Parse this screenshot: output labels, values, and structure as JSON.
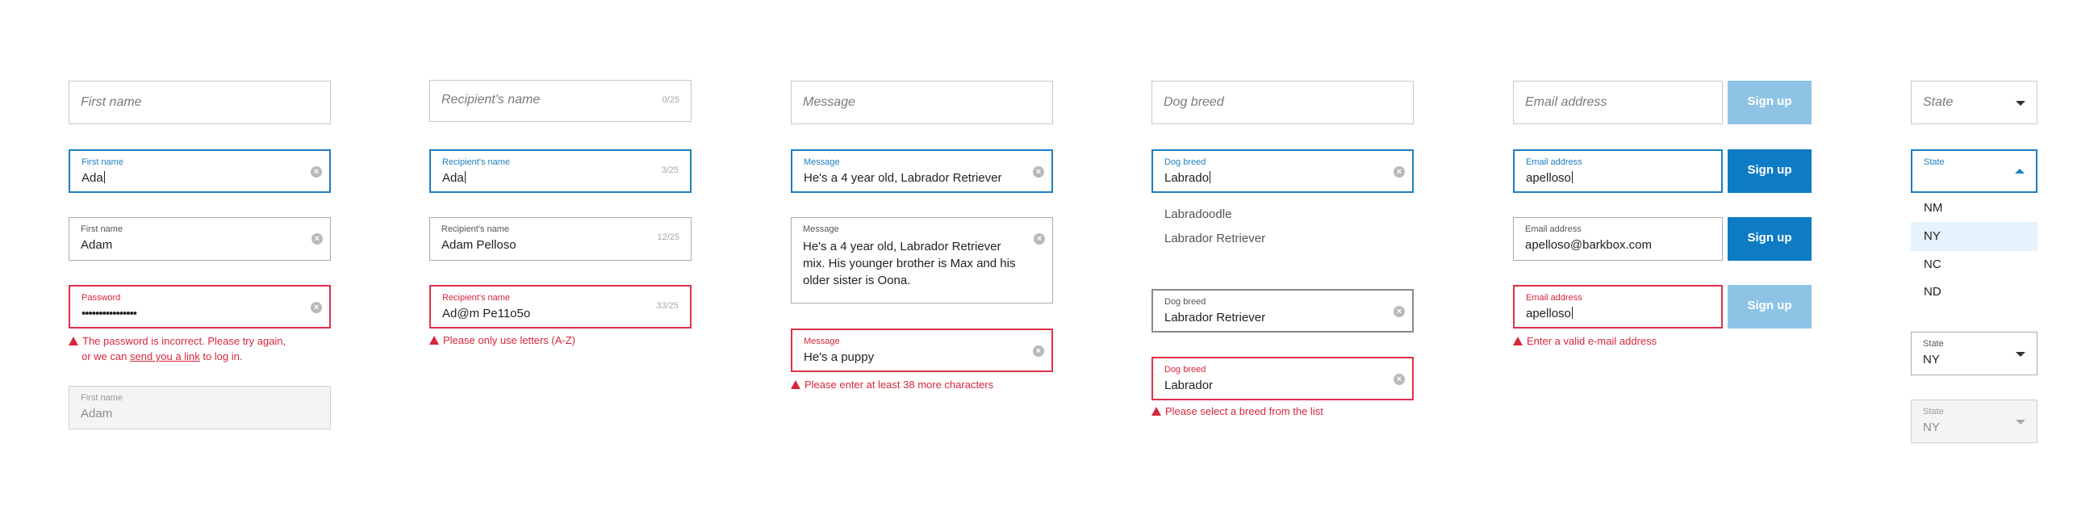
{
  "col1": {
    "empty": {
      "placeholder": "First name"
    },
    "focused": {
      "label": "First name",
      "value": "Ada"
    },
    "filled": {
      "label": "First name",
      "value": "Adam"
    },
    "error": {
      "label": "Password",
      "value": "••••••••••••••••",
      "msg_before": "The password is incorrect. Please try again,",
      "msg_or": "or we can ",
      "msg_link": "send you a link",
      "msg_after": " to log in."
    },
    "disabled": {
      "label": "First name",
      "value": "Adam"
    }
  },
  "col2": {
    "empty": {
      "placeholder": "Recipient's name",
      "count": "0/25"
    },
    "focused": {
      "label": "Recipient's name",
      "value": "Ada",
      "count": "3/25"
    },
    "filled": {
      "label": "Recipient's name",
      "value": "Adam Pelloso",
      "count": "12/25"
    },
    "error": {
      "label": "Recipient's name",
      "value": "Ad@m Pe11o5o",
      "count": "33/25",
      "msg": "Please only use letters (A-Z)"
    }
  },
  "col3": {
    "empty": {
      "placeholder": "Message"
    },
    "focused": {
      "label": "Message",
      "value": "He's a 4 year old, Labrador Retriever"
    },
    "filled": {
      "label": "Message",
      "value": "He's a 4 year old, Labrador Retriever mix. His younger brother is Max and his older sister is Oona."
    },
    "error": {
      "label": "Message",
      "value": "He's a puppy",
      "msg": "Please enter at least 38 more characters"
    }
  },
  "col4": {
    "empty": {
      "placeholder": "Dog breed"
    },
    "focused": {
      "label": "Dog breed",
      "value": "Labrado"
    },
    "suggestions": [
      "Labradoodle",
      "Labrador Retriever"
    ],
    "filled": {
      "label": "Dog breed",
      "value": "Labrador Retriever"
    },
    "error": {
      "label": "Dog breed",
      "value": "Labrador",
      "msg": "Please select a breed from the list"
    }
  },
  "col5": {
    "empty": {
      "placeholder": "Email address",
      "button": "Sign up"
    },
    "focused": {
      "label": "Email address",
      "value": "apelloso",
      "button": "Sign up"
    },
    "filled": {
      "label": "Email address",
      "value": "apelloso@barkbox.com",
      "button": "Sign up"
    },
    "error": {
      "label": "Email address",
      "value": "apelloso",
      "button": "Sign up",
      "msg": "Enter a valid e-mail address"
    }
  },
  "col6": {
    "empty": {
      "placeholder": "State"
    },
    "open": {
      "label": "State",
      "options": [
        "NM",
        "NY",
        "NC",
        "ND"
      ],
      "highlighted": "NY"
    },
    "filled": {
      "label": "State",
      "value": "NY"
    },
    "disabled": {
      "label": "State",
      "value": "NY"
    }
  },
  "colors": {
    "accent": "#1e7fc0",
    "error": "#d7263d",
    "button_disabled": "#8ec3e6",
    "button_active": "#0e7cc4",
    "highlight": "#e5f3fc"
  },
  "icons": {
    "clear": "clear-circle-icon",
    "warning": "warning-triangle-icon",
    "dropdown": "chevron-down-icon",
    "dropdown_open": "chevron-up-icon"
  }
}
